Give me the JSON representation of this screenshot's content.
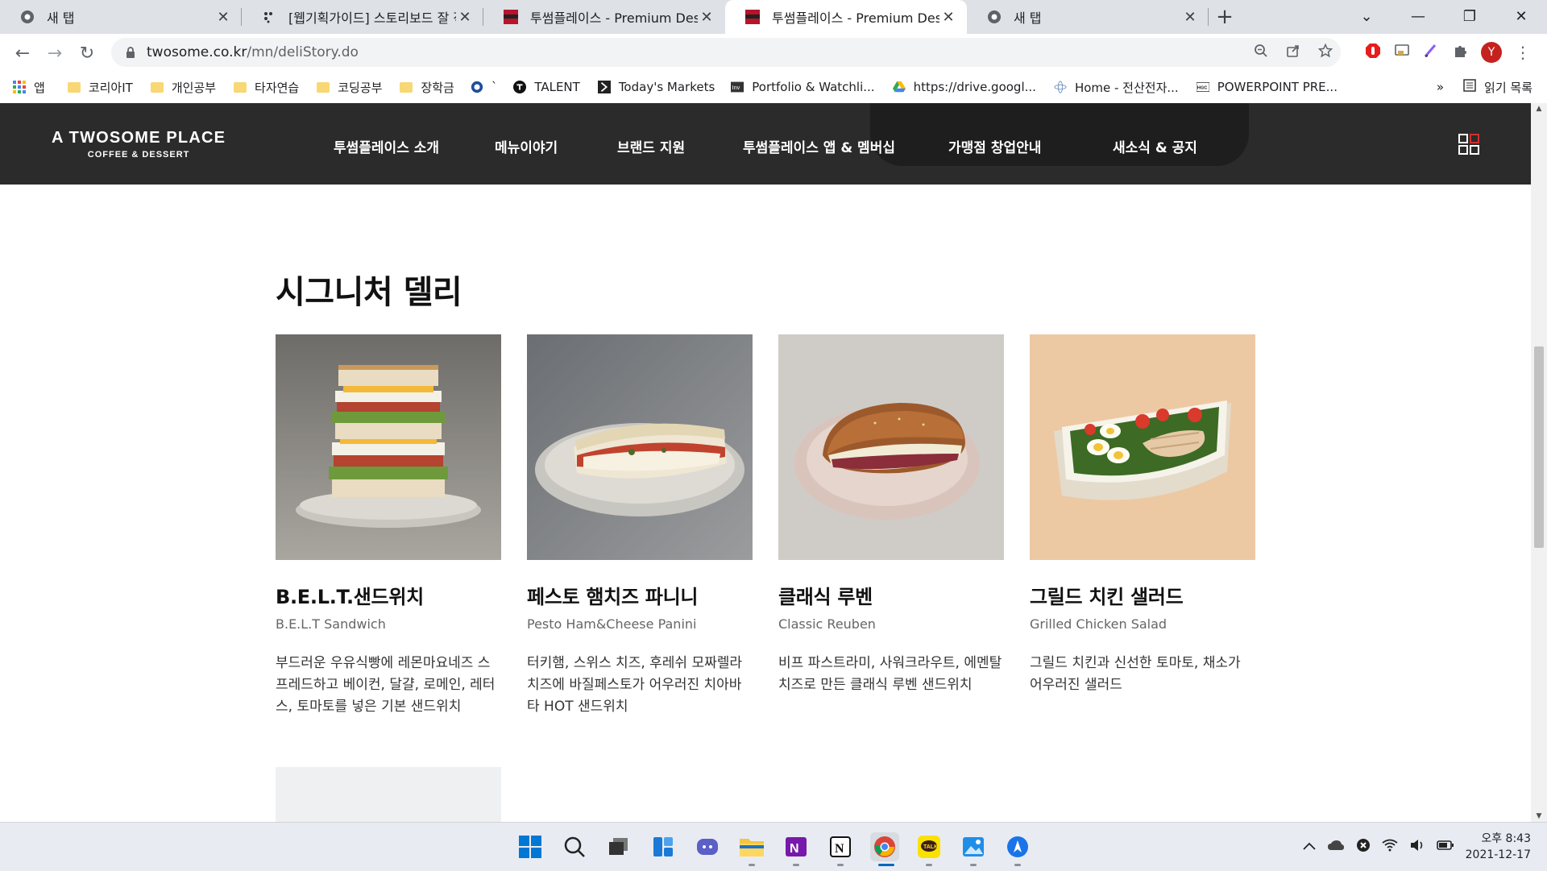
{
  "browser": {
    "tabs": [
      {
        "title": "새 탭",
        "favicon": "chrome-icon",
        "active": false
      },
      {
        "title": "[웹기획가이드] 스토리보드 잘 작",
        "favicon": "dots-icon",
        "active": false
      },
      {
        "title": "투썸플레이스 - Premium Desser",
        "favicon": "twosome-icon",
        "active": false
      },
      {
        "title": "투썸플레이스 - Premium Desser",
        "favicon": "twosome-icon",
        "active": true
      },
      {
        "title": "새 탭",
        "favicon": "chrome-icon",
        "active": false
      }
    ],
    "url_host": "twosome.co.kr",
    "url_path": "/mn/deliStory.do",
    "profile_initial": "Y",
    "bookmarks": [
      "앱",
      "코리아IT",
      "개인공부",
      "타자연습",
      "코딩공부",
      "장학금",
      "`",
      "TALENT",
      "Today's Markets",
      "Portfolio & Watchli...",
      "https://drive.googl...",
      "Home - 전산전자...",
      "POWERPOINT PRE..."
    ],
    "bookmarks_more": "»",
    "reading_list": "읽기 목록"
  },
  "site": {
    "logo_line1": "A TWOSOME PLACE",
    "logo_line2": "COFFEE & DESSERT",
    "nav": [
      "투썸플레이스 소개",
      "메뉴이야기",
      "브랜드 지원",
      "투썸플레이스 앱 & 멤버십",
      "가맹점 창업안내",
      "새소식 & 공지"
    ],
    "section_title": "시그니처 델리",
    "products": [
      {
        "name": "B.E.L.T.샌드위치",
        "english": "B.E.L.T Sandwich",
        "description": "부드러운 우유식빵에 레몬마요네즈 스프레드하고 베이컨, 달걀, 로메인, 레터스, 토마토를 넣은 기본 샌드위치"
      },
      {
        "name": "페스토 햄치즈 파니니",
        "english": "Pesto Ham&Cheese Panini",
        "description": "터키햄, 스위스 치즈, 후레쉬 모짜렐라치즈에 바질페스토가 어우러진 치아바타 HOT 샌드위치"
      },
      {
        "name": "클래식 루벤",
        "english": "Classic Reuben",
        "description": "비프 파스트라미, 사워크라우트, 에멘탈 치즈로 만든 클래식 루벤 샌드위치"
      },
      {
        "name": "그릴드 치킨 샐러드",
        "english": "Grilled Chicken Salad",
        "description": "그릴드 치킨과 신선한 토마토, 채소가 어우러진 샐러드"
      }
    ]
  },
  "taskbar": {
    "clock_time": "오후 8:43",
    "clock_date": "2021-12-17"
  },
  "colors": {
    "header_bg": "#2b2b2b",
    "chrome_frame": "#dee1e6",
    "accent_red": "#d32f2f"
  }
}
